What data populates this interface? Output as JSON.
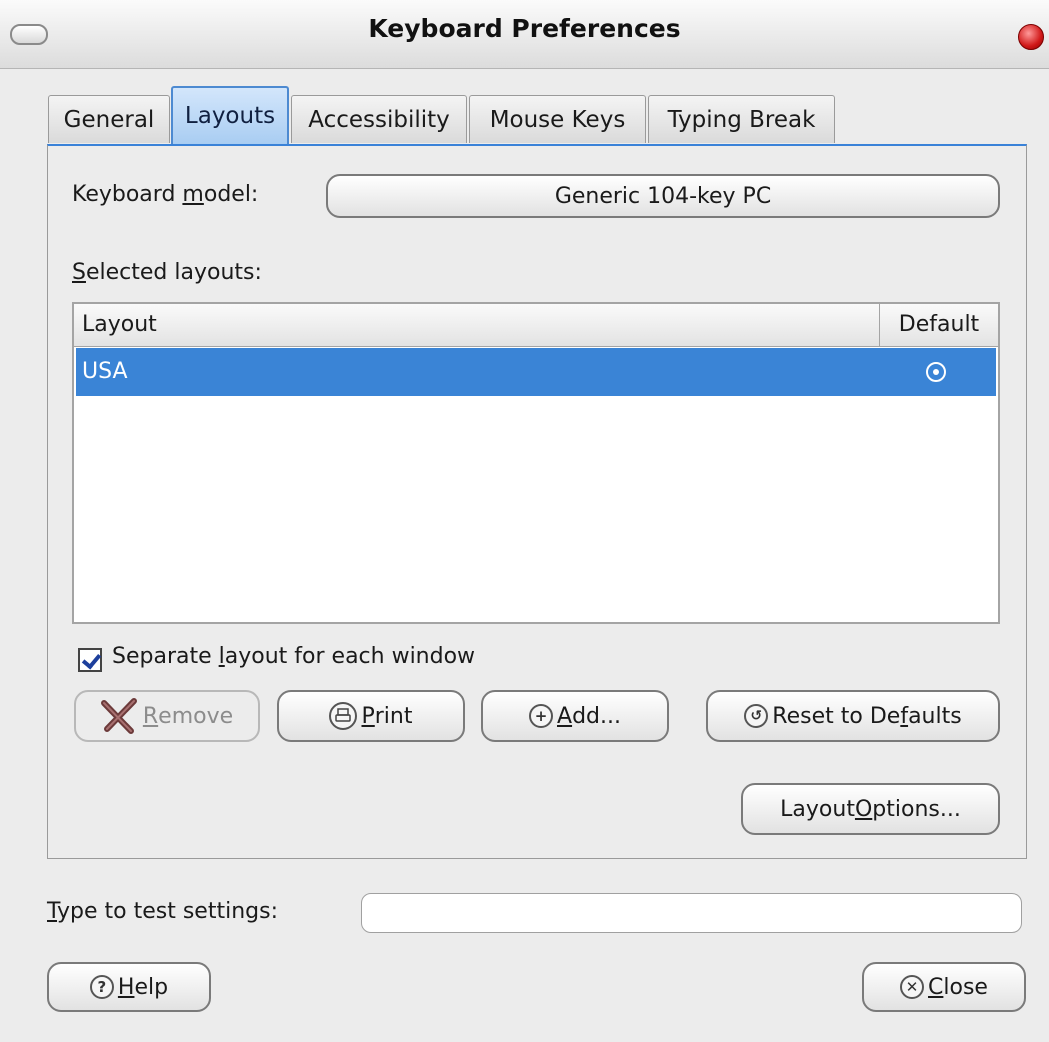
{
  "window": {
    "title": "Keyboard Preferences"
  },
  "tabs": [
    {
      "label": "General"
    },
    {
      "label": "Layouts"
    },
    {
      "label": "Accessibility"
    },
    {
      "label": "Mouse Keys"
    },
    {
      "label": "Typing Break"
    }
  ],
  "active_tab": "Layouts",
  "keyboard_model": {
    "label_pre": "Keyboard ",
    "label_ul": "m",
    "label_post": "odel:",
    "value": "Generic 104-key PC"
  },
  "selected_layouts": {
    "label_ul": "S",
    "label_post": "elected layouts:",
    "columns": [
      "Layout",
      "Default"
    ],
    "rows": [
      {
        "name": "USA",
        "default": true
      }
    ]
  },
  "separate_layout": {
    "label_pre": "Separate ",
    "label_ul": "l",
    "label_post": "ayout for each window",
    "checked": true
  },
  "buttons": {
    "remove": {
      "ul": "R",
      "rest": "emove",
      "enabled": false
    },
    "print": {
      "ul": "P",
      "rest": "rint"
    },
    "add": {
      "ul": "A",
      "rest": "dd..."
    },
    "reset": {
      "pre": "Reset to De",
      "ul": "f",
      "post": "aults"
    },
    "layout_options": {
      "pre": "Layout ",
      "ul": "O",
      "post": "ptions..."
    },
    "help": {
      "ul": "H",
      "rest": "elp"
    },
    "close": {
      "ul": "C",
      "rest": "lose"
    }
  },
  "test_settings": {
    "label_ul": "T",
    "label_post": "ype to test settings:",
    "value": ""
  },
  "icons": {
    "remove": "x-cross-icon",
    "print": "printer-icon",
    "add": "plus-icon",
    "reset": "revert-icon",
    "help": "question-icon",
    "close": "close-x-icon"
  },
  "colors": {
    "selection": "#3a84d6",
    "active_tab": "#a9cdf2",
    "close_button": "#d01818"
  }
}
